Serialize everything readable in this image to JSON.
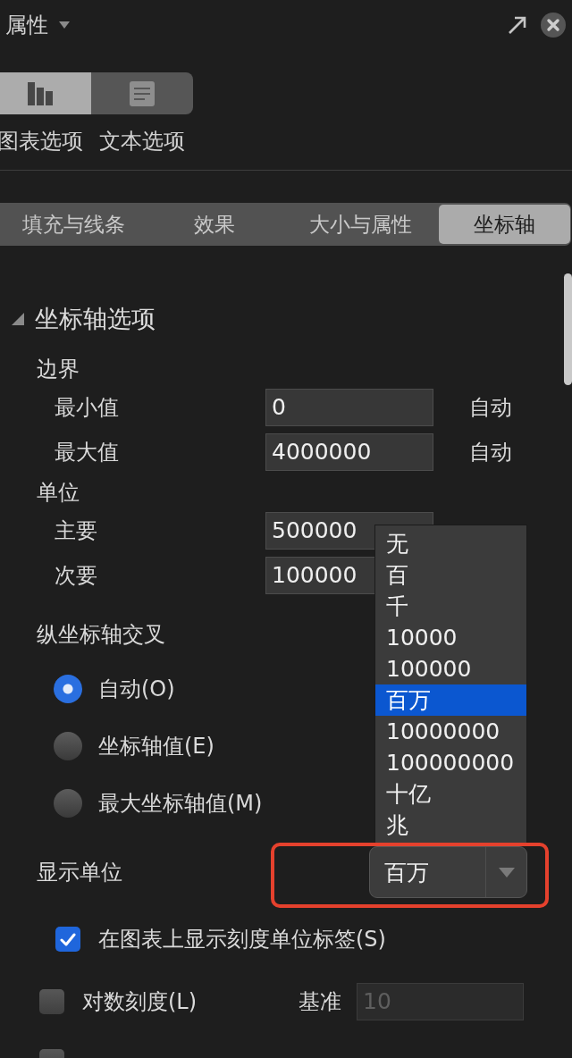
{
  "header": {
    "title": "属性"
  },
  "view_switch": [
    {
      "kind": "chart",
      "label": "图表选项",
      "selected": true
    },
    {
      "kind": "text",
      "label": "文本选项",
      "selected": false
    }
  ],
  "tabs": [
    {
      "label": "填充与线条",
      "selected": false
    },
    {
      "label": "效果",
      "selected": false
    },
    {
      "label": "大小与属性",
      "selected": false
    },
    {
      "label": "坐标轴",
      "selected": true
    }
  ],
  "axis_options": {
    "title": "坐标轴选项",
    "expanded": true,
    "groups": [
      {
        "title": "边界",
        "rows": [
          {
            "label": "最小值",
            "value": "0",
            "auto_label": "自动"
          },
          {
            "label": "最大值",
            "value": "4000000",
            "auto_label": "自动"
          }
        ]
      },
      {
        "title": "单位",
        "rows": [
          {
            "label": "主要",
            "value": "500000"
          },
          {
            "label": "次要",
            "value": "100000"
          }
        ]
      }
    ],
    "axis_crosses": {
      "title": "纵坐标轴交叉",
      "options": [
        {
          "label": "自动(O)",
          "selected": true
        },
        {
          "label": "坐标轴值(E)",
          "selected": false
        },
        {
          "label": "最大坐标轴值(M)",
          "selected": false
        }
      ]
    },
    "display_unit": {
      "label": "显示单位",
      "value": "百万",
      "expanded": true,
      "highlighted": true,
      "options": [
        {
          "label": "无",
          "selected": false
        },
        {
          "label": "百",
          "selected": false
        },
        {
          "label": "千",
          "selected": false
        },
        {
          "label": "10000",
          "selected": false
        },
        {
          "label": "100000",
          "selected": false
        },
        {
          "label": "百万",
          "selected": true
        },
        {
          "label": "10000000",
          "selected": false
        },
        {
          "label": "100000000",
          "selected": false
        },
        {
          "label": "十亿",
          "selected": false
        },
        {
          "label": "兆",
          "selected": false
        }
      ],
      "show_unit_label": {
        "label": "在图表上显示刻度单位标签(S)",
        "checked": true
      }
    },
    "checkboxes": [
      {
        "label": "对数刻度(L)",
        "checked": false,
        "base": {
          "label": "基准",
          "value": "10",
          "disabled": true
        }
      },
      {
        "checked": false
      }
    ]
  }
}
